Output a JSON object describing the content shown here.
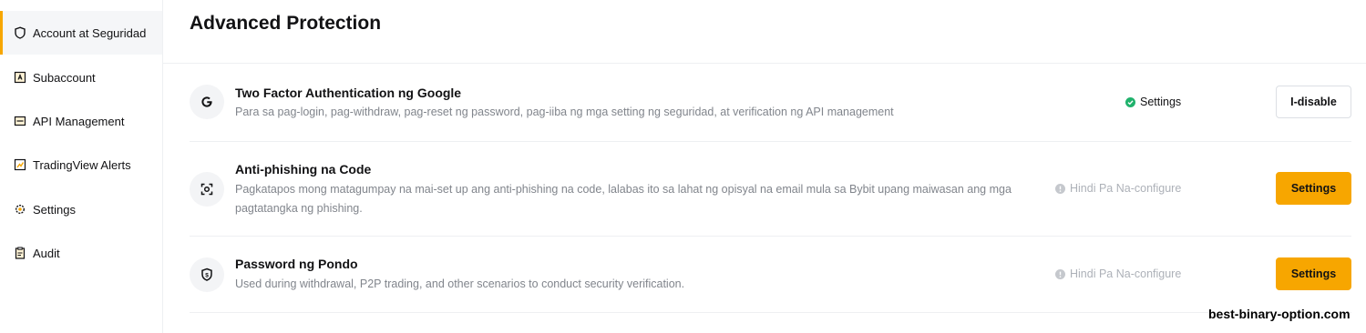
{
  "sidebar": {
    "items": [
      {
        "label": "Account at Seguridad",
        "icon": "shield-icon"
      },
      {
        "label": "Subaccount",
        "icon": "subaccount-icon"
      },
      {
        "label": "API Management",
        "icon": "api-icon"
      },
      {
        "label": "TradingView Alerts",
        "icon": "alert-icon"
      },
      {
        "label": "Settings",
        "icon": "gear-icon"
      },
      {
        "label": "Audit",
        "icon": "clipboard-icon"
      }
    ]
  },
  "main": {
    "title": "Advanced Protection",
    "rows": [
      {
        "icon": "google-icon",
        "title": "Two Factor Authentication ng Google",
        "description": "Para sa pag-login, pag-withdraw, pag-reset ng password, pag-iiba ng mga setting ng seguridad, at verification ng API management",
        "status": "Settings",
        "button": "I-disable"
      },
      {
        "icon": "anti-phishing-icon",
        "title": "Anti-phishing na Code",
        "description": "Pagkatapos mong matagumpay na mai-set up ang anti-phishing na code, lalabas ito sa lahat ng opisyal na email mula sa Bybit upang maiwasan ang mga pagtatangka ng phishing.",
        "status": "Hindi Pa Na-configure",
        "button": "Settings"
      },
      {
        "icon": "fund-password-icon",
        "title": "Password ng Pondo",
        "description": "Used during withdrawal, P2P trading, and other scenarios to conduct security verification.",
        "status": "Hindi Pa Na-configure",
        "button": "Settings"
      }
    ]
  },
  "watermark": "best-binary-option.com",
  "colors": {
    "accent": "#f7a600",
    "success": "#20b26c",
    "muted": "#81858c"
  }
}
